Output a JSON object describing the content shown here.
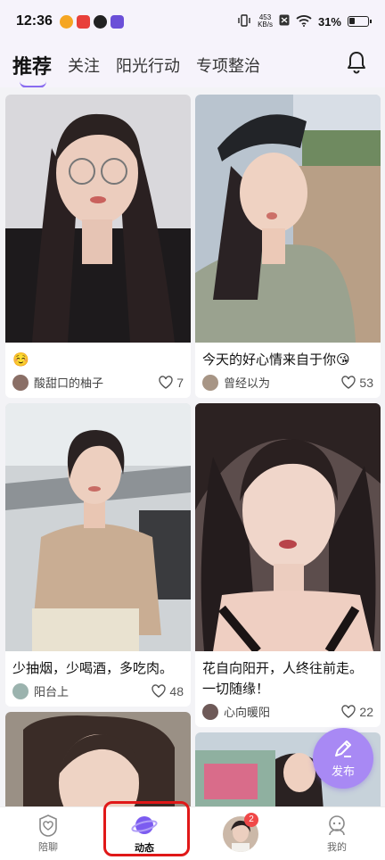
{
  "status": {
    "time": "12:36",
    "net_speed_value": "453",
    "net_speed_unit": "KB/s",
    "battery": "31%"
  },
  "header": {
    "tabs": [
      {
        "label": "推荐",
        "active": true
      },
      {
        "label": "关注"
      },
      {
        "label": "阳光行动"
      },
      {
        "label": "专项整治"
      }
    ]
  },
  "feed": {
    "left": [
      {
        "caption": "☺️",
        "user": "酸甜口的柚子",
        "likes": "7",
        "photo_theme": "woman-glasses-dark-top"
      },
      {
        "caption": "少抽烟，少喝酒，多吃肉。",
        "user": "阳台上",
        "likes": "48",
        "photo_theme": "woman-beige-top-airport"
      },
      {
        "caption": "",
        "user": "",
        "likes": "",
        "photo_theme": "woman-portrait"
      }
    ],
    "right": [
      {
        "caption": "今天的好心情来自于你😘",
        "user": "曾经以为",
        "likes": "53",
        "photo_theme": "woman-cap-selfie"
      },
      {
        "caption": "花自向阳开，人终往前走。一切随缘！",
        "user": "心向暖阳",
        "likes": "22",
        "photo_theme": "woman-selfie-indoor"
      },
      {
        "caption": "",
        "user": "",
        "likes": "",
        "photo_theme": "woman-mall"
      }
    ]
  },
  "fab": {
    "label": "发布",
    "icon": "pencil-icon"
  },
  "bottom_nav": [
    {
      "label": "陪聊",
      "icon": "heart-chat-icon"
    },
    {
      "label": "动态",
      "icon": "planet-icon",
      "active": true
    },
    {
      "label": "",
      "icon": "avatar",
      "badge": "2"
    },
    {
      "label": "我的",
      "icon": "profile-icon"
    }
  ],
  "colors": {
    "accent": "#8a6cf0",
    "fab": "#a889f4",
    "badge": "#f04848",
    "highlight": "#e01818"
  }
}
